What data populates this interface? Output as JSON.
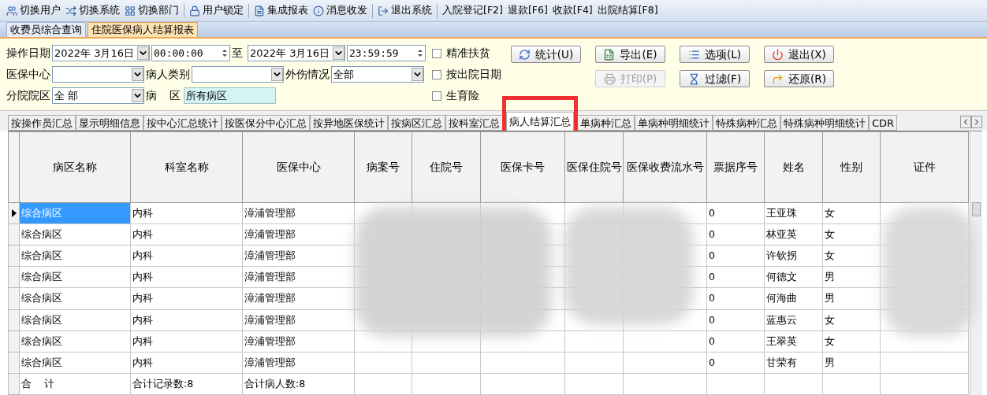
{
  "toolbar": [
    {
      "label": "切换用户",
      "kind": "icon"
    },
    {
      "label": "切换系统",
      "kind": "icon"
    },
    {
      "label": "切换部门",
      "kind": "icon",
      "separator": true
    },
    {
      "label": "用户锁定",
      "kind": "icon",
      "separator": true
    },
    {
      "label": "集成报表",
      "kind": "icon"
    },
    {
      "label": "消息收发",
      "kind": "icon",
      "separator": true
    },
    {
      "label": "退出系统",
      "kind": "icon",
      "separator": true
    },
    {
      "label": "入院登记[F2]",
      "kind": "text"
    },
    {
      "label": "退款[F6]",
      "kind": "text"
    },
    {
      "label": "收款[F4]",
      "kind": "text"
    },
    {
      "label": "出院结算[F8]",
      "kind": "text"
    }
  ],
  "doc_tabs": [
    {
      "label": "收费员综合查询",
      "selected": false
    },
    {
      "label": "住院医保病人结算报表",
      "selected": true
    }
  ],
  "filter_rows": [
    [
      {
        "kind": "label",
        "text": "操作日期"
      },
      {
        "kind": "dropdown",
        "value": "2022年  3月16日"
      },
      {
        "kind": "spinner",
        "value": "00:00:00"
      },
      {
        "kind": "label",
        "text": "至"
      },
      {
        "kind": "dropdown",
        "value": "2022年  3月16日"
      },
      {
        "kind": "spinner",
        "value": "23:59:59"
      }
    ],
    [
      {
        "kind": "label",
        "text": "医保中心"
      },
      {
        "kind": "dropdown"
      },
      {
        "kind": "label",
        "text": "病人类别"
      },
      {
        "kind": "dropdown"
      },
      {
        "kind": "label",
        "text": "外伤情况"
      },
      {
        "kind": "dropdown",
        "value": "全部"
      }
    ],
    [
      {
        "kind": "label",
        "text": "分院院区"
      },
      {
        "kind": "dropdown",
        "value": "全  部"
      },
      {
        "kind": "label",
        "text": "病"
      },
      {
        "kind": "label",
        "text": "区"
      },
      {
        "kind": "text",
        "value": "所有病区"
      }
    ]
  ],
  "checkboxes": [
    {
      "label": "精准扶贫",
      "checked": false
    },
    {
      "label": "按出院日期",
      "checked": false
    },
    {
      "label": "生育险",
      "checked": false
    }
  ],
  "buttons": [
    [
      {
        "label": "统计(U)",
        "disabled": false
      },
      {
        "label": "导出(E)",
        "disabled": false
      },
      {
        "label": "选项(L)",
        "disabled": false
      },
      {
        "label": "退出(X)",
        "disabled": false
      }
    ],
    [
      {
        "label": "打印(P)",
        "disabled": true
      },
      {
        "label": "过滤(F)",
        "disabled": false
      },
      {
        "label": "还原(R)",
        "disabled": false
      }
    ]
  ],
  "report_tabs": [
    {
      "label": "按操作员汇总",
      "selected": false
    },
    {
      "label": "显示明细信息",
      "selected": false
    },
    {
      "label": "按中心汇总统计",
      "selected": false
    },
    {
      "label": "按医保分中心汇总",
      "selected": false
    },
    {
      "label": "按异地医保统计",
      "selected": false
    },
    {
      "label": "按病区汇总",
      "selected": false
    },
    {
      "label": "按科室汇总",
      "selected": false
    },
    {
      "label": "病人结算汇总",
      "selected": true
    },
    {
      "label": "单病种汇总",
      "selected": false
    },
    {
      "label": "单病种明细统计",
      "selected": false
    },
    {
      "label": "特殊病种汇总",
      "selected": false
    },
    {
      "label": "特殊病种明细统计",
      "selected": false
    },
    {
      "label": "CDR",
      "selected": false
    }
  ],
  "table": {
    "columns": [
      "病区名称",
      "科室名称",
      "医保中心",
      "病案号",
      "住院号",
      "医保卡号",
      "医保住院号",
      "医保收费流水号",
      "票据序号",
      "姓名",
      "性别",
      "证件"
    ],
    "rows": [
      {
        "selected": true,
        "cells": [
          "综合病区",
          "内科",
          "漳浦管理部",
          null,
          null,
          null,
          null,
          null,
          "0",
          "王亚珠",
          "女",
          null
        ]
      },
      {
        "selected": false,
        "cells": [
          "综合病区",
          "内科",
          "漳浦管理部",
          null,
          null,
          null,
          null,
          null,
          "0",
          "林亚英",
          "女",
          null
        ]
      },
      {
        "selected": false,
        "cells": [
          "综合病区",
          "内科",
          "漳浦管理部",
          null,
          null,
          null,
          null,
          null,
          "0",
          "许钦拐",
          "女",
          null
        ]
      },
      {
        "selected": false,
        "cells": [
          "综合病区",
          "内科",
          "漳浦管理部",
          null,
          null,
          null,
          null,
          null,
          "0",
          "何德文",
          "男",
          null
        ]
      },
      {
        "selected": false,
        "cells": [
          "综合病区",
          "内科",
          "漳浦管理部",
          null,
          null,
          null,
          null,
          null,
          "0",
          "何海曲",
          "男",
          null
        ]
      },
      {
        "selected": false,
        "cells": [
          "综合病区",
          "内科",
          "漳浦管理部",
          null,
          null,
          null,
          null,
          null,
          "0",
          "蓝惠云",
          "女",
          null
        ]
      },
      {
        "selected": false,
        "cells": [
          "综合病区",
          "内科",
          "漳浦管理部",
          null,
          null,
          null,
          null,
          null,
          "0",
          "王翠英",
          "女",
          null
        ]
      },
      {
        "selected": false,
        "cells": [
          "综合病区",
          "内科",
          "漳浦管理部",
          null,
          null,
          null,
          null,
          null,
          "0",
          "甘荣有",
          "男",
          null
        ]
      }
    ],
    "summary": [
      "合    计",
      "合计记录数:8",
      "合计病人数:8"
    ]
  }
}
